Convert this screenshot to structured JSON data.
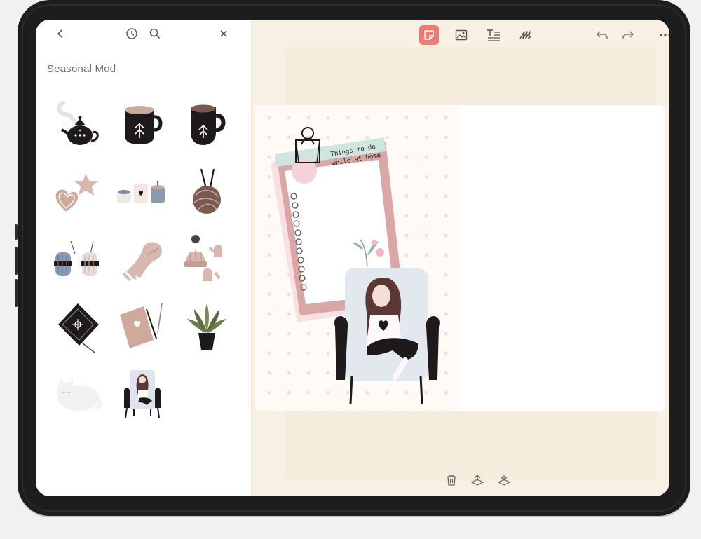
{
  "sticker_panel": {
    "title": "Seasonal Mod",
    "tools": [
      "back-chevron-icon",
      "history-clock-icon",
      "search-icon",
      "close-icon"
    ],
    "stickers": [
      "teapot-sticker",
      "mug-light-sticker",
      "mug-dark-sticker",
      "heart-star-cookies-sticker",
      "candles-sticker",
      "yarn-needles-sticker",
      "yarn-skeins-sticker",
      "scarf-sticker",
      "hat-mittens-sticker",
      "book-sticker",
      "notebook-sticker",
      "potted-plant-sticker",
      "cat-sticker",
      "girl-armchair-sticker"
    ]
  },
  "toolbar": {
    "tools": [
      {
        "icon": "sticker-icon",
        "active": true
      },
      {
        "icon": "image-icon",
        "active": false
      },
      {
        "icon": "text-icon",
        "active": false
      },
      {
        "icon": "scribble-icon",
        "active": false
      }
    ],
    "right": [
      "undo-icon",
      "redo-icon",
      "more-icon"
    ]
  },
  "canvas": {
    "note_title": "Things to do while at home"
  },
  "bottom_bar": [
    "trash-icon",
    "move-up-icon",
    "move-down-icon"
  ],
  "colors": {
    "accent": "#f37a74",
    "canvas_bg": "#f8f0e3",
    "dot": "#f8dada"
  }
}
